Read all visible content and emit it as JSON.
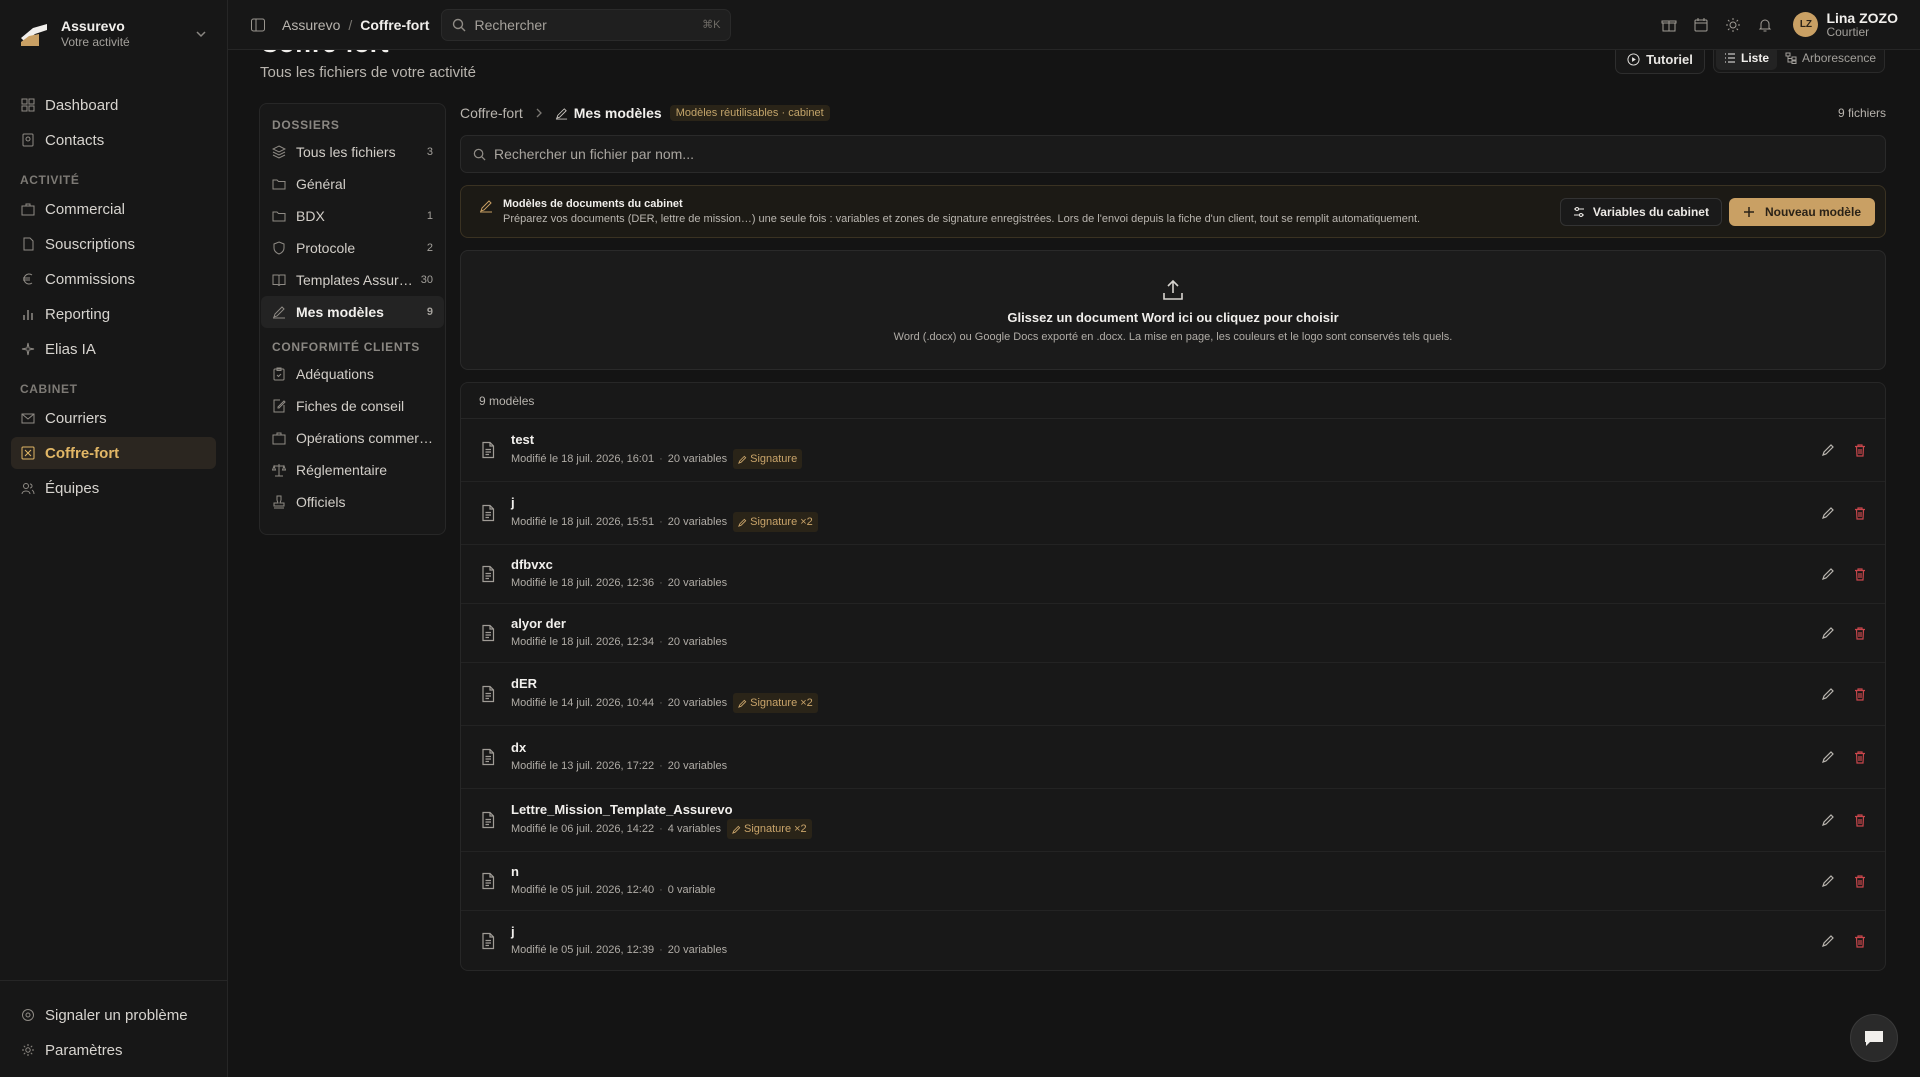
{
  "brand": {
    "name": "Assurevo",
    "subtitle": "Votre activité"
  },
  "sidebar": {
    "main_items": [
      {
        "label": "Dashboard",
        "icon": "grid-icon"
      },
      {
        "label": "Contacts",
        "icon": "contacts-icon"
      }
    ],
    "sections": [
      {
        "title": "ACTIVITÉ",
        "items": [
          {
            "label": "Commercial",
            "icon": "briefcase-icon"
          },
          {
            "label": "Souscriptions",
            "icon": "file-icon"
          },
          {
            "label": "Commissions",
            "icon": "euro-icon"
          },
          {
            "label": "Reporting",
            "icon": "bar-chart-icon"
          },
          {
            "label": "Elias IA",
            "icon": "sparkle-icon"
          }
        ]
      },
      {
        "title": "CABINET",
        "items": [
          {
            "label": "Courriers",
            "icon": "mail-icon"
          },
          {
            "label": "Coffre-fort",
            "icon": "vault-icon",
            "active": true
          },
          {
            "label": "Équipes",
            "icon": "users-icon"
          }
        ]
      }
    ],
    "bottom_items": [
      {
        "label": "Signaler un problème",
        "icon": "bug-icon"
      },
      {
        "label": "Paramètres",
        "icon": "gear-icon"
      }
    ]
  },
  "topbar": {
    "breadcrumb": [
      "Assurevo",
      "Coffre-fort"
    ],
    "search_placeholder": "Rechercher",
    "search_shortcut": "⌘K",
    "user": {
      "initials": "LZ",
      "name": "Lina ZOZO",
      "role": "Courtier"
    }
  },
  "page": {
    "title": "Coffre-fort",
    "subtitle": "Tous les fichiers de votre activité",
    "tutorial_label": "Tutoriel",
    "view_list": "Liste",
    "view_tree": "Arborescence"
  },
  "folders": {
    "section1": "DOSSIERS",
    "items": [
      {
        "label": "Tous les fichiers",
        "count": "3",
        "icon": "layers-icon"
      },
      {
        "label": "Général",
        "count": "",
        "icon": "folder-icon"
      },
      {
        "label": "BDX",
        "count": "1",
        "icon": "folder-icon"
      },
      {
        "label": "Protocole",
        "count": "2",
        "icon": "shield-icon"
      },
      {
        "label": "Templates Assureurs",
        "count": "30",
        "icon": "book-icon"
      },
      {
        "label": "Mes modèles",
        "count": "9",
        "icon": "pen-icon",
        "active": true
      }
    ],
    "section2": "CONFORMITÉ CLIENTS",
    "items2": [
      {
        "label": "Adéquations",
        "icon": "clipboard-icon"
      },
      {
        "label": "Fiches de conseil",
        "icon": "edit-doc-icon"
      },
      {
        "label": "Opérations commerciales",
        "icon": "briefcase-icon"
      },
      {
        "label": "Réglementaire",
        "icon": "scale-icon"
      },
      {
        "label": "Officiels",
        "icon": "stamp-icon"
      }
    ]
  },
  "content": {
    "crumb_root": "Coffre-fort",
    "crumb_current": "Mes modèles",
    "crumb_tag": "Modèles réutilisables · cabinet",
    "file_count": "9 fichiers",
    "search_placeholder": "Rechercher un fichier par nom...",
    "banner": {
      "title": "Modèles de documents du cabinet",
      "desc": "Préparez vos documents (DER, lettre de mission…) une seule fois : variables et zones de signature enregistrées. Lors de l'envoi depuis la fiche d'un client, tout se remplit automatiquement.",
      "vars_button": "Variables du cabinet",
      "new_button": "Nouveau modèle"
    },
    "dropzone": {
      "title": "Glissez un document Word ici ou cliquez pour choisir",
      "desc": "Word (.docx) ou Google Docs exporté en .docx. La mise en page, les couleurs et le logo sont conservés tels quels."
    },
    "list_header": "9 modèles",
    "templates": [
      {
        "name": "test",
        "modified": "Modifié le 18 juil. 2026, 16:01",
        "variables": "20 variables",
        "signature": "Signature"
      },
      {
        "name": "j",
        "modified": "Modifié le 18 juil. 2026, 15:51",
        "variables": "20 variables",
        "signature": "Signature ×2"
      },
      {
        "name": "dfbvxc",
        "modified": "Modifié le 18 juil. 2026, 12:36",
        "variables": "20 variables",
        "signature": ""
      },
      {
        "name": "alyor der",
        "modified": "Modifié le 18 juil. 2026, 12:34",
        "variables": "20 variables",
        "signature": ""
      },
      {
        "name": "dER",
        "modified": "Modifié le 14 juil. 2026, 10:44",
        "variables": "20 variables",
        "signature": "Signature ×2"
      },
      {
        "name": "dx",
        "modified": "Modifié le 13 juil. 2026, 17:22",
        "variables": "20 variables",
        "signature": ""
      },
      {
        "name": "Lettre_Mission_Template_Assurevo",
        "modified": "Modifié le 06 juil. 2026, 14:22",
        "variables": "4 variables",
        "signature": "Signature ×2"
      },
      {
        "name": "n",
        "modified": "Modifié le 05 juil. 2026, 12:40",
        "variables": "0 variable",
        "signature": ""
      },
      {
        "name": "j",
        "modified": "Modifié le 05 juil. 2026, 12:39",
        "variables": "20 variables",
        "signature": ""
      }
    ]
  },
  "colors": {
    "accent": "#c9a064",
    "background": "#141414",
    "danger": "#c9464b"
  }
}
